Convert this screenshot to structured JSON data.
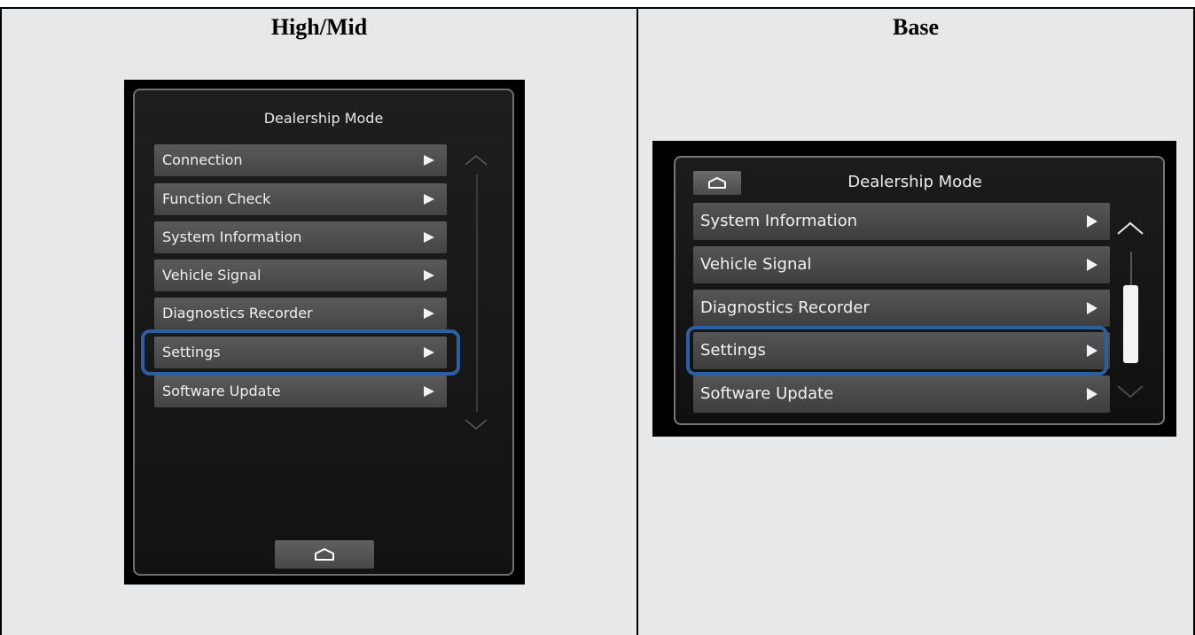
{
  "left_panel": {
    "heading": "High/Mid",
    "screen_title": "Dealership Mode",
    "menu_items": [
      {
        "label": "Connection"
      },
      {
        "label": "Function Check"
      },
      {
        "label": "System Information"
      },
      {
        "label": "Vehicle Signal"
      },
      {
        "label": "Diagnostics Recorder"
      },
      {
        "label": "Settings"
      },
      {
        "label": "Software Update"
      }
    ],
    "highlighted_item": "Settings",
    "icons": {
      "home": "home-icon",
      "item_arrow": "play-arrow-icon",
      "scroll_up": "chevron-up-icon",
      "scroll_down": "chevron-down-icon"
    }
  },
  "right_panel": {
    "heading": "Base",
    "screen_title": "Dealership Mode",
    "menu_items": [
      {
        "label": "System Information"
      },
      {
        "label": "Vehicle Signal"
      },
      {
        "label": "Diagnostics Recorder"
      },
      {
        "label": "Settings"
      },
      {
        "label": "Software Update"
      }
    ],
    "highlighted_item": "Settings",
    "icons": {
      "home": "home-icon",
      "item_arrow": "play-arrow-icon",
      "scroll_up": "chevron-up-icon",
      "scroll_down": "chevron-down-icon"
    }
  },
  "colors": {
    "highlight": "#2d5fa3",
    "cell_background": "#e7e8ea",
    "screen_background": "#000000"
  }
}
